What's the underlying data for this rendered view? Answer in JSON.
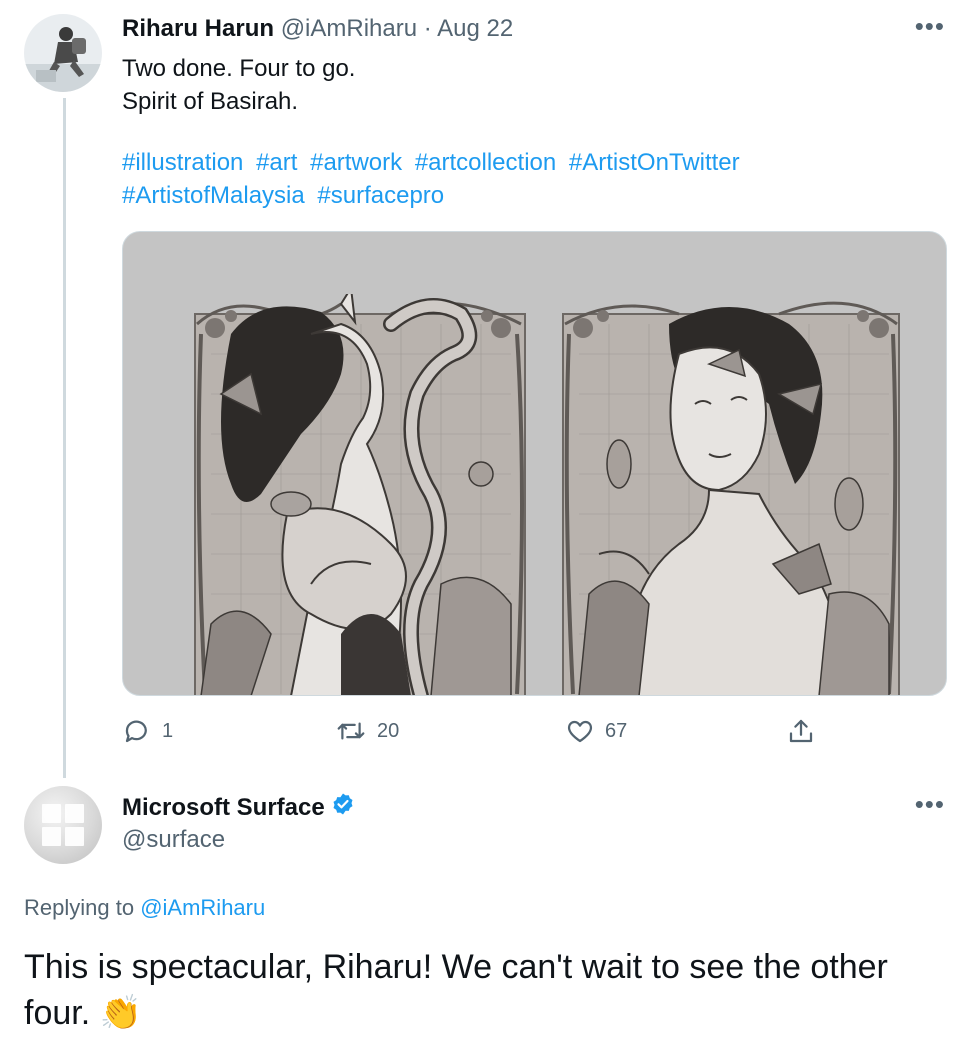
{
  "tweet1": {
    "author_name": "Riharu Harun",
    "author_handle": "@iAmRiharu",
    "separator": "·",
    "date": "Aug 22",
    "more_label": "•••",
    "text_lines": [
      "Two done. Four to go.",
      "Spirit of Basirah."
    ],
    "hashtags": [
      "#illustration",
      "#art",
      "#artwork",
      "#artcollection",
      "#ArtistOnTwitter",
      "#ArtistofMalaysia",
      "#surfacepro"
    ],
    "actions": {
      "reply_count": "1",
      "retweet_count": "20",
      "like_count": "67"
    }
  },
  "tweet2": {
    "author_name": "Microsoft Surface",
    "verified": true,
    "author_handle": "@surface",
    "more_label": "•••",
    "replying_prefix": "Replying to",
    "replying_to": "@iAmRiharu",
    "text": "This is spectacular, Riharu! We can't wait to see the other four. 👏"
  },
  "colors": {
    "link": "#1d9bf0",
    "secondary_text": "#536471",
    "thread_line": "#cfd9de",
    "verified_badge": "#1d9bf0",
    "media_background": "#c4c4c4"
  },
  "icons": {
    "reply": "speech-bubble-icon",
    "retweet": "retweet-arrows-icon",
    "like": "heart-icon",
    "share": "share-upload-icon",
    "verified": "verified-badge-icon"
  }
}
